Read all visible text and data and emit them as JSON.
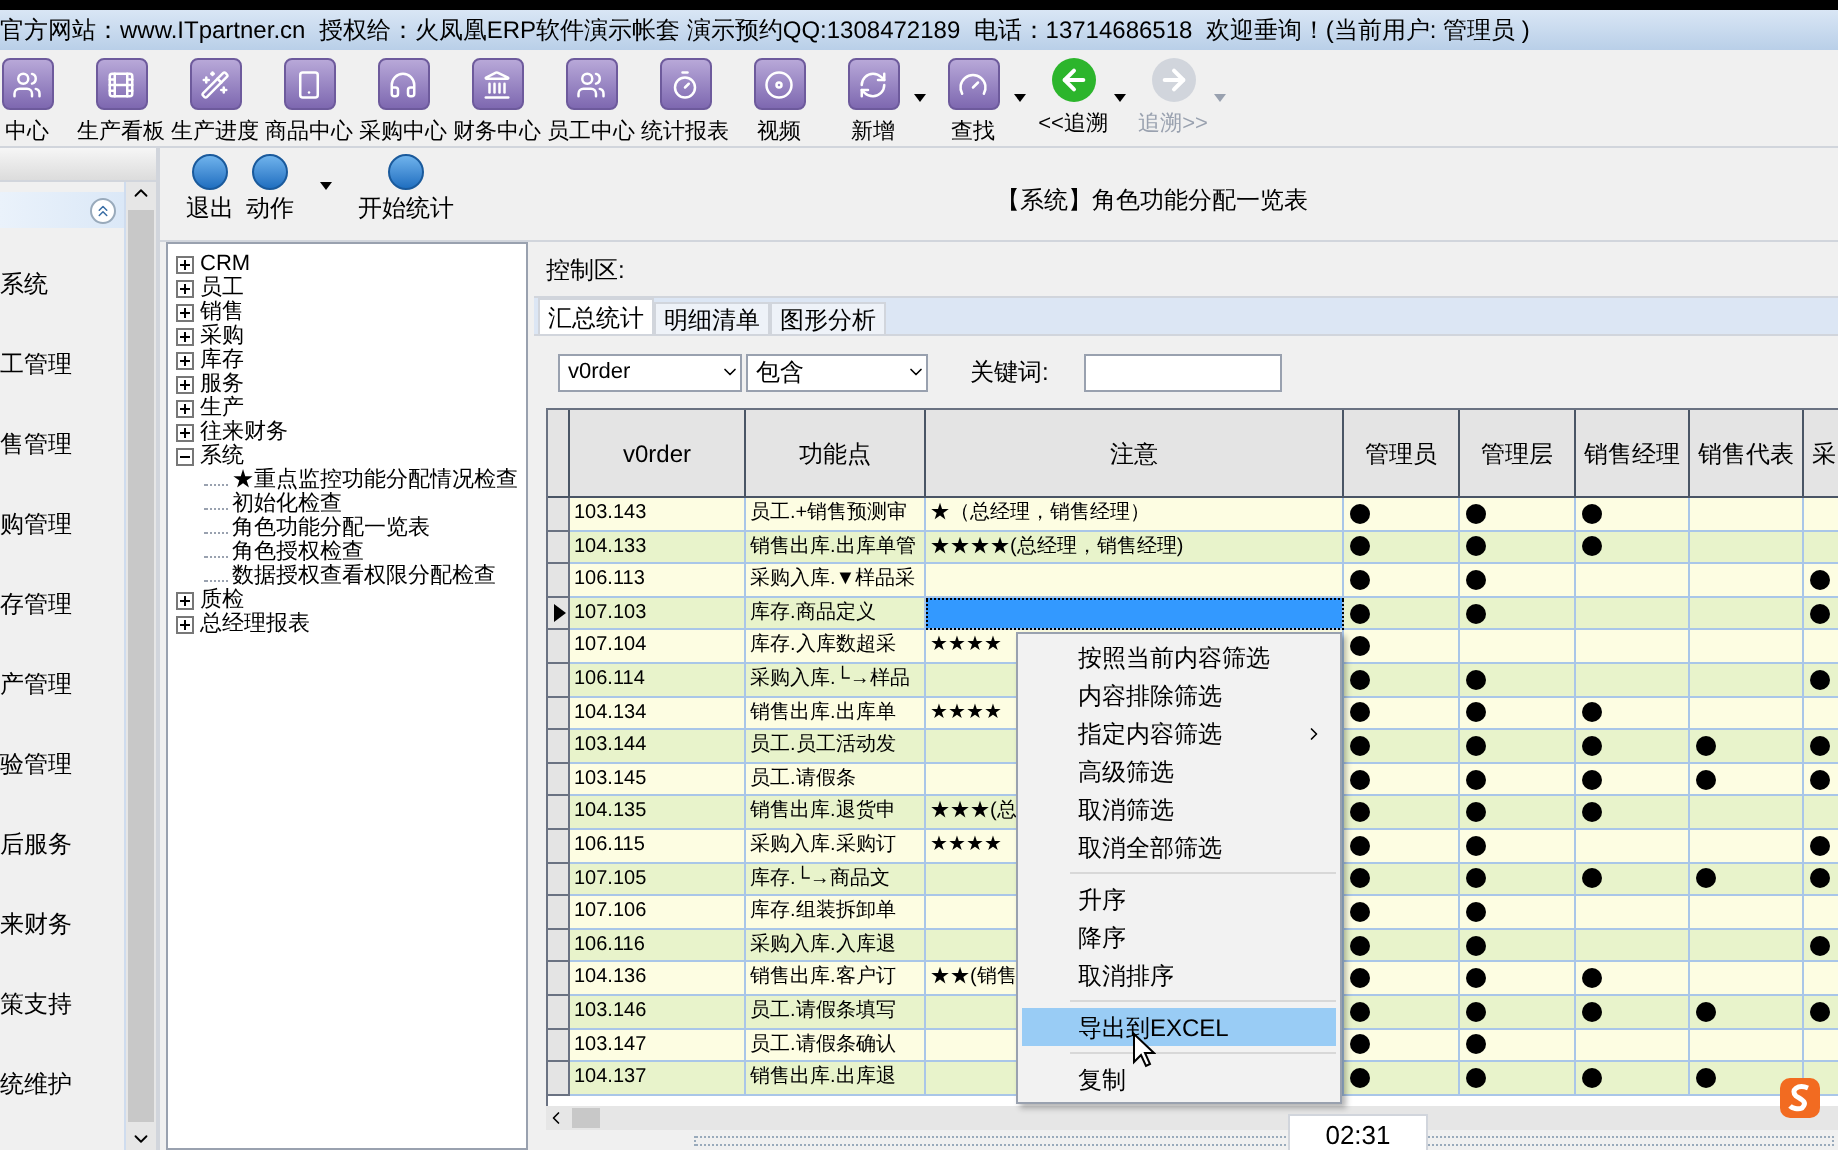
{
  "info_bar": "官方网站：www.ITpartner.cn  授权给：火凤凰ERP软件演示帐套 演示预约QQ:1308472189  电话：13714686518  欢迎垂询！(当前用户: 管理员 )",
  "toolbar": [
    {
      "label": "中心",
      "dropdown": false,
      "disabled": false
    },
    {
      "label": "生产看板",
      "dropdown": false,
      "disabled": false
    },
    {
      "label": "生产进度",
      "dropdown": false,
      "disabled": false
    },
    {
      "label": "商品中心",
      "dropdown": false,
      "disabled": false
    },
    {
      "label": "采购中心",
      "dropdown": false,
      "disabled": false
    },
    {
      "label": "财务中心",
      "dropdown": false,
      "disabled": false
    },
    {
      "label": "员工中心",
      "dropdown": false,
      "disabled": false
    },
    {
      "label": "统计报表",
      "dropdown": false,
      "disabled": false
    },
    {
      "label": "视频",
      "dropdown": false,
      "disabled": false
    },
    {
      "label": "新增",
      "dropdown": true,
      "disabled": false
    },
    {
      "label": "查找",
      "dropdown": true,
      "disabled": false
    },
    {
      "label": "<<追溯",
      "dropdown": true,
      "disabled": false
    },
    {
      "label": "追溯>>",
      "dropdown": true,
      "disabled": true
    }
  ],
  "sidebar": {
    "items": [
      {
        "label": "系统",
        "selected": false
      },
      {
        "label": "工管理",
        "selected": false
      },
      {
        "label": "售管理",
        "selected": false
      },
      {
        "label": "购管理",
        "selected": false
      },
      {
        "label": "存管理",
        "selected": false
      },
      {
        "label": "产管理",
        "selected": false
      },
      {
        "label": "验管理",
        "selected": false
      },
      {
        "label": "后服务",
        "selected": false
      },
      {
        "label": "来财务",
        "selected": false
      },
      {
        "label": "策支持",
        "selected": false
      },
      {
        "label": "统维护",
        "selected": false
      }
    ]
  },
  "actions": [
    {
      "label": "退出",
      "dropdown": false
    },
    {
      "label": "动作",
      "dropdown": true
    },
    {
      "label": "开始统计",
      "dropdown": false
    }
  ],
  "report_title": "【系统】角色功能分配一览表",
  "tree": [
    {
      "label": "CRM",
      "expanded": false
    },
    {
      "label": "员工",
      "expanded": false
    },
    {
      "label": "销售",
      "expanded": false
    },
    {
      "label": "采购",
      "expanded": false
    },
    {
      "label": "库存",
      "expanded": false
    },
    {
      "label": "服务",
      "expanded": false
    },
    {
      "label": "生产",
      "expanded": false
    },
    {
      "label": "往来财务",
      "expanded": false
    },
    {
      "label": "系统",
      "expanded": true,
      "children": [
        {
          "label": "★重点监控功能分配情况检查"
        },
        {
          "label": "初始化检查"
        },
        {
          "label": "角色功能分配一览表"
        },
        {
          "label": "角色授权检查"
        },
        {
          "label": "数据授权查看权限分配检查"
        }
      ]
    },
    {
      "label": "质检",
      "expanded": false
    },
    {
      "label": "总经理报表",
      "expanded": false
    }
  ],
  "control_label": "控制区:",
  "tabs": [
    {
      "label": "汇总统计",
      "selected": true
    },
    {
      "label": "明细清单",
      "selected": false
    },
    {
      "label": "图形分析",
      "selected": false
    }
  ],
  "filter": {
    "field": "v0rder",
    "operator": "包含",
    "keyword_label": "关键词:"
  },
  "table": {
    "columns": [
      "v0rder",
      "功能点",
      "注意",
      "管理员",
      "管理层",
      "销售经理",
      "销售代表",
      "采"
    ],
    "rows": [
      {
        "order": "103.143",
        "function": "员工.+销售预测审",
        "note": "★（总经理，销售经理）",
        "selected": false,
        "roles": [
          true,
          true,
          true,
          false,
          false
        ]
      },
      {
        "order": "104.133",
        "function": "销售出库.出库单管",
        "note": "★★★★(总经理，销售经理)",
        "selected": false,
        "roles": [
          true,
          true,
          true,
          false,
          false
        ]
      },
      {
        "order": "106.113",
        "function": "采购入库.▼样品采",
        "selected": false,
        "roles": [
          true,
          true,
          false,
          false,
          true
        ]
      },
      {
        "order": "107.103",
        "function": "库存.商品定义",
        "selected": true,
        "roles": [
          true,
          true,
          false,
          false,
          true
        ]
      },
      {
        "order": "107.104",
        "function": "库存.入库数超采",
        "note": "★★★★",
        "selected": false,
        "roles": [
          true,
          false,
          false,
          false,
          false
        ]
      },
      {
        "order": "106.114",
        "function": "采购入库.└→样品",
        "selected": false,
        "roles": [
          true,
          true,
          false,
          false,
          true
        ]
      },
      {
        "order": "104.134",
        "function": "销售出库.出库单",
        "note": "★★★★",
        "selected": false,
        "roles": [
          true,
          true,
          true,
          false,
          false
        ]
      },
      {
        "order": "103.144",
        "function": "员工.员工活动发",
        "selected": false,
        "roles": [
          true,
          true,
          true,
          true,
          true
        ]
      },
      {
        "order": "103.145",
        "function": "员工.请假条",
        "selected": false,
        "roles": [
          true,
          true,
          true,
          true,
          true
        ]
      },
      {
        "order": "104.135",
        "function": "销售出库.退货申",
        "note": "★★★(总",
        "selected": false,
        "roles": [
          true,
          true,
          true,
          false,
          false
        ]
      },
      {
        "order": "106.115",
        "function": "采购入库.采购订",
        "note": "★★★★",
        "selected": false,
        "roles": [
          true,
          true,
          false,
          false,
          true
        ]
      },
      {
        "order": "107.105",
        "function": "库存.└→商品文",
        "selected": false,
        "roles": [
          true,
          true,
          true,
          true,
          true
        ]
      },
      {
        "order": "107.106",
        "function": "库存.组装拆卸单",
        "selected": false,
        "roles": [
          true,
          true,
          false,
          false,
          false
        ]
      },
      {
        "order": "106.116",
        "function": "采购入库.入库退",
        "selected": false,
        "roles": [
          true,
          true,
          false,
          false,
          true
        ]
      },
      {
        "order": "104.136",
        "function": "销售出库.客户订",
        "note": "★★(销售",
        "selected": false,
        "roles": [
          true,
          true,
          true,
          false,
          false
        ]
      },
      {
        "order": "103.146",
        "function": "员工.请假条填写",
        "selected": false,
        "roles": [
          true,
          true,
          true,
          true,
          true
        ]
      },
      {
        "order": "103.147",
        "function": "员工.请假条确认",
        "selected": false,
        "roles": [
          true,
          true,
          false,
          false,
          false
        ]
      },
      {
        "order": "104.137",
        "function": "销售出库.出库退",
        "selected": false,
        "roles": [
          true,
          true,
          true,
          true,
          false
        ]
      }
    ]
  },
  "context_menu": [
    {
      "kind": "item",
      "label": "按照当前内容筛选",
      "selected": false
    },
    {
      "kind": "item",
      "label": "内容排除筛选",
      "selected": false
    },
    {
      "kind": "submenu",
      "label": "指定内容筛选",
      "selected": false
    },
    {
      "kind": "item",
      "label": "高级筛选",
      "selected": false
    },
    {
      "kind": "item",
      "label": "取消筛选",
      "selected": false
    },
    {
      "kind": "item",
      "label": "取消全部筛选",
      "selected": false
    },
    {
      "kind": "separator"
    },
    {
      "kind": "item",
      "label": "升序",
      "selected": false
    },
    {
      "kind": "item",
      "label": "降序",
      "selected": false
    },
    {
      "kind": "item",
      "label": "取消排序",
      "selected": false
    },
    {
      "kind": "separator"
    },
    {
      "kind": "item",
      "label": "导出到EXCEL",
      "selected": true
    },
    {
      "kind": "separator"
    },
    {
      "kind": "item",
      "label": "复制",
      "selected": false
    }
  ],
  "clock": "02:31"
}
